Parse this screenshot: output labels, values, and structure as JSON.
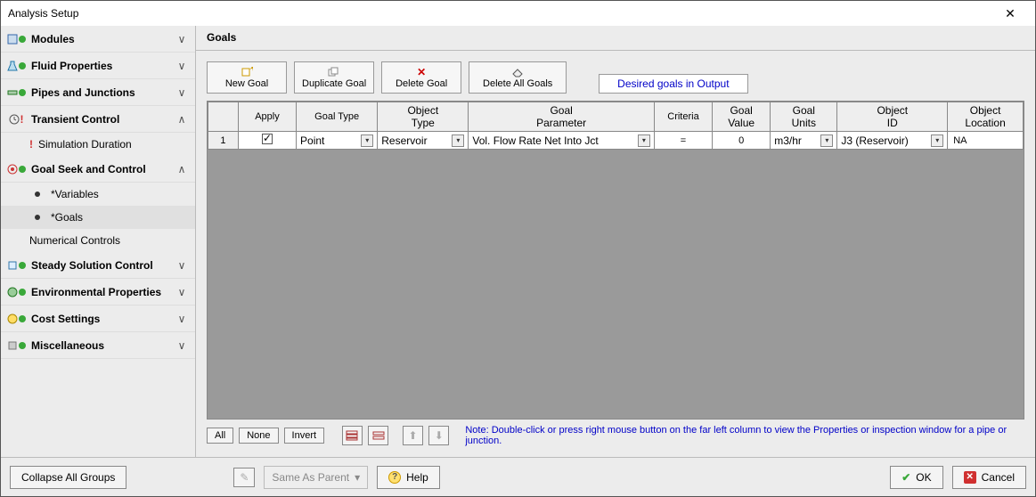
{
  "window": {
    "title": "Analysis Setup"
  },
  "sidebar": {
    "items": [
      {
        "label": "Modules",
        "expand": "∨"
      },
      {
        "label": "Fluid Properties",
        "expand": "∨"
      },
      {
        "label": "Pipes and Junctions",
        "expand": "∨"
      },
      {
        "label": "Transient Control",
        "expand": "∧"
      },
      {
        "label": "Goal Seek and Control",
        "expand": "∧"
      },
      {
        "label": "Steady Solution Control",
        "expand": "∨"
      },
      {
        "label": "Environmental Properties",
        "expand": "∨"
      },
      {
        "label": "Cost Settings",
        "expand": "∨"
      },
      {
        "label": "Miscellaneous",
        "expand": "∨"
      }
    ],
    "transient_sub": {
      "simulation_duration": "Simulation Duration"
    },
    "gsc_sub": {
      "variables": "*Variables",
      "goals": "*Goals",
      "numerical": "Numerical Controls"
    }
  },
  "main": {
    "title": "Goals",
    "toolbar": {
      "new_goal": "New Goal",
      "duplicate_goal": "Duplicate Goal",
      "delete_goal": "Delete Goal",
      "delete_all": "Delete All Goals",
      "desired": "Desired goals in Output"
    },
    "grid": {
      "headers": {
        "row": "",
        "apply": "Apply",
        "goal_type": "Goal Type",
        "object_type": "Object\nType",
        "goal_parameter": "Goal\nParameter",
        "criteria": "Criteria",
        "goal_value": "Goal\nValue",
        "goal_units": "Goal\nUnits",
        "object_id": "Object\nID",
        "object_location": "Object\nLocation"
      },
      "row1": {
        "num": "1",
        "goal_type": "Point",
        "object_type": "Reservoir",
        "goal_parameter": "Vol. Flow Rate Net Into Jct",
        "criteria": "=",
        "goal_value": "0",
        "goal_units": "m3/hr",
        "object_id": "J3 (Reservoir)",
        "object_location": "NA"
      }
    },
    "below": {
      "all": "All",
      "none": "None",
      "invert": "Invert",
      "note": "Note: Double-click or press right mouse button on the far left column to view the Properties or inspection window for a pipe or junction."
    }
  },
  "footer": {
    "collapse": "Collapse All Groups",
    "same_as_parent": "Same As Parent",
    "help": "Help",
    "ok": "OK",
    "cancel": "Cancel"
  }
}
